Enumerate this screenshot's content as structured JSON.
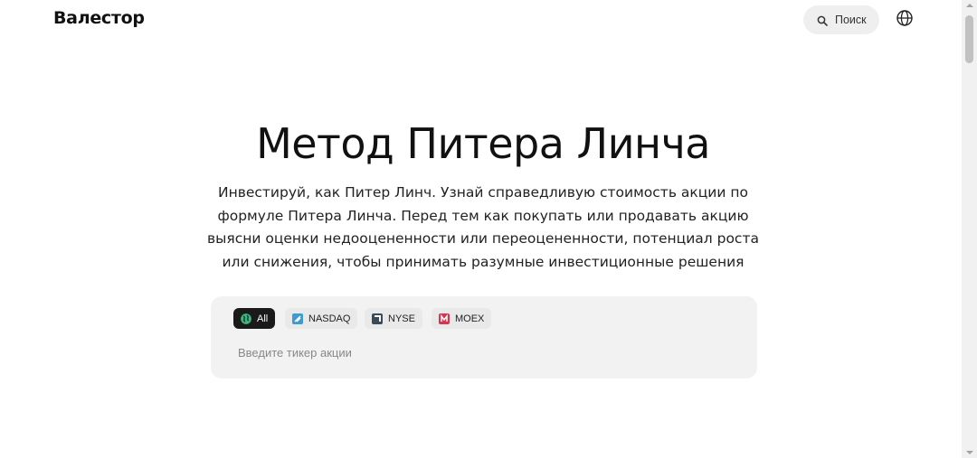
{
  "header": {
    "logo": "Валестор",
    "search_label": "Поиск",
    "language_icon": "globe-icon"
  },
  "hero": {
    "title": "Метод Питера Линча",
    "description_lines": [
      "Инвестируй, как Питер Линч. Узнай справедливую стоимость акции по",
      "формуле Питера Линча. Перед тем как покупать или продавать акцию",
      "выясни оценки недооцененности или переоцененности, потенциал роста",
      "или снижения, чтобы принимать разумные инвестиционные решения"
    ]
  },
  "exchange_filter": {
    "chips": [
      {
        "label": "All",
        "icon": "globe-icon",
        "active": true,
        "color": "#1a1a1a"
      },
      {
        "label": "NASDAQ",
        "icon": "nasdaq-icon",
        "active": false,
        "color": "#3a9bd5"
      },
      {
        "label": "NYSE",
        "icon": "nyse-icon",
        "active": false,
        "color": "#3b4a5a"
      },
      {
        "label": "MOEX",
        "icon": "moex-icon",
        "active": false,
        "color": "#d9344f"
      }
    ],
    "ticker_placeholder": "Введите тикер акции"
  }
}
